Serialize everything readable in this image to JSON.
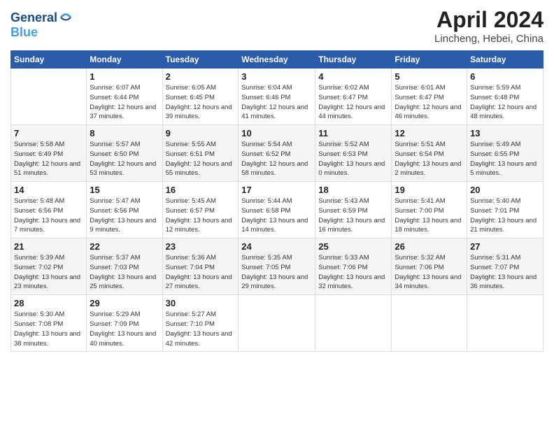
{
  "header": {
    "logo_line1": "General",
    "logo_line2": "Blue",
    "month_title": "April 2024",
    "location": "Lincheng, Hebei, China"
  },
  "weekdays": [
    "Sunday",
    "Monday",
    "Tuesday",
    "Wednesday",
    "Thursday",
    "Friday",
    "Saturday"
  ],
  "weeks": [
    [
      {
        "num": "",
        "sunrise": "",
        "sunset": "",
        "daylight": ""
      },
      {
        "num": "1",
        "sunrise": "Sunrise: 6:07 AM",
        "sunset": "Sunset: 6:44 PM",
        "daylight": "Daylight: 12 hours and 37 minutes."
      },
      {
        "num": "2",
        "sunrise": "Sunrise: 6:05 AM",
        "sunset": "Sunset: 6:45 PM",
        "daylight": "Daylight: 12 hours and 39 minutes."
      },
      {
        "num": "3",
        "sunrise": "Sunrise: 6:04 AM",
        "sunset": "Sunset: 6:46 PM",
        "daylight": "Daylight: 12 hours and 41 minutes."
      },
      {
        "num": "4",
        "sunrise": "Sunrise: 6:02 AM",
        "sunset": "Sunset: 6:47 PM",
        "daylight": "Daylight: 12 hours and 44 minutes."
      },
      {
        "num": "5",
        "sunrise": "Sunrise: 6:01 AM",
        "sunset": "Sunset: 6:47 PM",
        "daylight": "Daylight: 12 hours and 46 minutes."
      },
      {
        "num": "6",
        "sunrise": "Sunrise: 5:59 AM",
        "sunset": "Sunset: 6:48 PM",
        "daylight": "Daylight: 12 hours and 48 minutes."
      }
    ],
    [
      {
        "num": "7",
        "sunrise": "Sunrise: 5:58 AM",
        "sunset": "Sunset: 6:49 PM",
        "daylight": "Daylight: 12 hours and 51 minutes."
      },
      {
        "num": "8",
        "sunrise": "Sunrise: 5:57 AM",
        "sunset": "Sunset: 6:50 PM",
        "daylight": "Daylight: 12 hours and 53 minutes."
      },
      {
        "num": "9",
        "sunrise": "Sunrise: 5:55 AM",
        "sunset": "Sunset: 6:51 PM",
        "daylight": "Daylight: 12 hours and 55 minutes."
      },
      {
        "num": "10",
        "sunrise": "Sunrise: 5:54 AM",
        "sunset": "Sunset: 6:52 PM",
        "daylight": "Daylight: 12 hours and 58 minutes."
      },
      {
        "num": "11",
        "sunrise": "Sunrise: 5:52 AM",
        "sunset": "Sunset: 6:53 PM",
        "daylight": "Daylight: 13 hours and 0 minutes."
      },
      {
        "num": "12",
        "sunrise": "Sunrise: 5:51 AM",
        "sunset": "Sunset: 6:54 PM",
        "daylight": "Daylight: 13 hours and 2 minutes."
      },
      {
        "num": "13",
        "sunrise": "Sunrise: 5:49 AM",
        "sunset": "Sunset: 6:55 PM",
        "daylight": "Daylight: 13 hours and 5 minutes."
      }
    ],
    [
      {
        "num": "14",
        "sunrise": "Sunrise: 5:48 AM",
        "sunset": "Sunset: 6:56 PM",
        "daylight": "Daylight: 13 hours and 7 minutes."
      },
      {
        "num": "15",
        "sunrise": "Sunrise: 5:47 AM",
        "sunset": "Sunset: 6:56 PM",
        "daylight": "Daylight: 13 hours and 9 minutes."
      },
      {
        "num": "16",
        "sunrise": "Sunrise: 5:45 AM",
        "sunset": "Sunset: 6:57 PM",
        "daylight": "Daylight: 13 hours and 12 minutes."
      },
      {
        "num": "17",
        "sunrise": "Sunrise: 5:44 AM",
        "sunset": "Sunset: 6:58 PM",
        "daylight": "Daylight: 13 hours and 14 minutes."
      },
      {
        "num": "18",
        "sunrise": "Sunrise: 5:43 AM",
        "sunset": "Sunset: 6:59 PM",
        "daylight": "Daylight: 13 hours and 16 minutes."
      },
      {
        "num": "19",
        "sunrise": "Sunrise: 5:41 AM",
        "sunset": "Sunset: 7:00 PM",
        "daylight": "Daylight: 13 hours and 18 minutes."
      },
      {
        "num": "20",
        "sunrise": "Sunrise: 5:40 AM",
        "sunset": "Sunset: 7:01 PM",
        "daylight": "Daylight: 13 hours and 21 minutes."
      }
    ],
    [
      {
        "num": "21",
        "sunrise": "Sunrise: 5:39 AM",
        "sunset": "Sunset: 7:02 PM",
        "daylight": "Daylight: 13 hours and 23 minutes."
      },
      {
        "num": "22",
        "sunrise": "Sunrise: 5:37 AM",
        "sunset": "Sunset: 7:03 PM",
        "daylight": "Daylight: 13 hours and 25 minutes."
      },
      {
        "num": "23",
        "sunrise": "Sunrise: 5:36 AM",
        "sunset": "Sunset: 7:04 PM",
        "daylight": "Daylight: 13 hours and 27 minutes."
      },
      {
        "num": "24",
        "sunrise": "Sunrise: 5:35 AM",
        "sunset": "Sunset: 7:05 PM",
        "daylight": "Daylight: 13 hours and 29 minutes."
      },
      {
        "num": "25",
        "sunrise": "Sunrise: 5:33 AM",
        "sunset": "Sunset: 7:06 PM",
        "daylight": "Daylight: 13 hours and 32 minutes."
      },
      {
        "num": "26",
        "sunrise": "Sunrise: 5:32 AM",
        "sunset": "Sunset: 7:06 PM",
        "daylight": "Daylight: 13 hours and 34 minutes."
      },
      {
        "num": "27",
        "sunrise": "Sunrise: 5:31 AM",
        "sunset": "Sunset: 7:07 PM",
        "daylight": "Daylight: 13 hours and 36 minutes."
      }
    ],
    [
      {
        "num": "28",
        "sunrise": "Sunrise: 5:30 AM",
        "sunset": "Sunset: 7:08 PM",
        "daylight": "Daylight: 13 hours and 38 minutes."
      },
      {
        "num": "29",
        "sunrise": "Sunrise: 5:29 AM",
        "sunset": "Sunset: 7:09 PM",
        "daylight": "Daylight: 13 hours and 40 minutes."
      },
      {
        "num": "30",
        "sunrise": "Sunrise: 5:27 AM",
        "sunset": "Sunset: 7:10 PM",
        "daylight": "Daylight: 13 hours and 42 minutes."
      },
      {
        "num": "",
        "sunrise": "",
        "sunset": "",
        "daylight": ""
      },
      {
        "num": "",
        "sunrise": "",
        "sunset": "",
        "daylight": ""
      },
      {
        "num": "",
        "sunrise": "",
        "sunset": "",
        "daylight": ""
      },
      {
        "num": "",
        "sunrise": "",
        "sunset": "",
        "daylight": ""
      }
    ]
  ]
}
